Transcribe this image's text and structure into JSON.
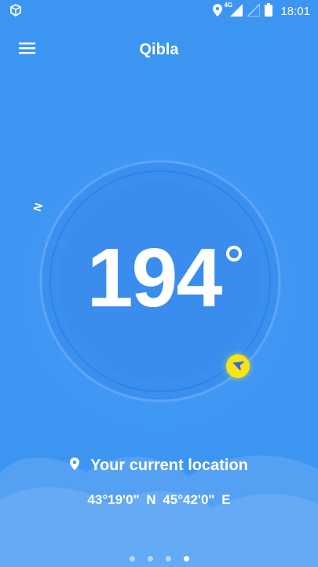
{
  "status_bar": {
    "time": "18:01",
    "network": "4G",
    "icons": [
      "app-notification-icon",
      "location-icon",
      "signal-4g-icon",
      "signal-empty-icon",
      "battery-icon"
    ]
  },
  "app_bar": {
    "title": "Qibla",
    "menu_icon": "hamburger-menu-icon"
  },
  "compass": {
    "heading": "194",
    "degree_symbol": "°",
    "north_label": "N",
    "qibla_marker_icon": "navigation-arrow-icon"
  },
  "location": {
    "label": "Your current location",
    "pin_icon": "location-pin-icon",
    "coordinates": "43°19'0\" N  45°42'0\" E"
  },
  "pager": {
    "pages": 4,
    "active_index": 3
  },
  "colors": {
    "background": "#3d95f2",
    "compass_ring": "#3b8fee",
    "qibla_marker": "#f5e41a",
    "text": "#ffffff"
  }
}
